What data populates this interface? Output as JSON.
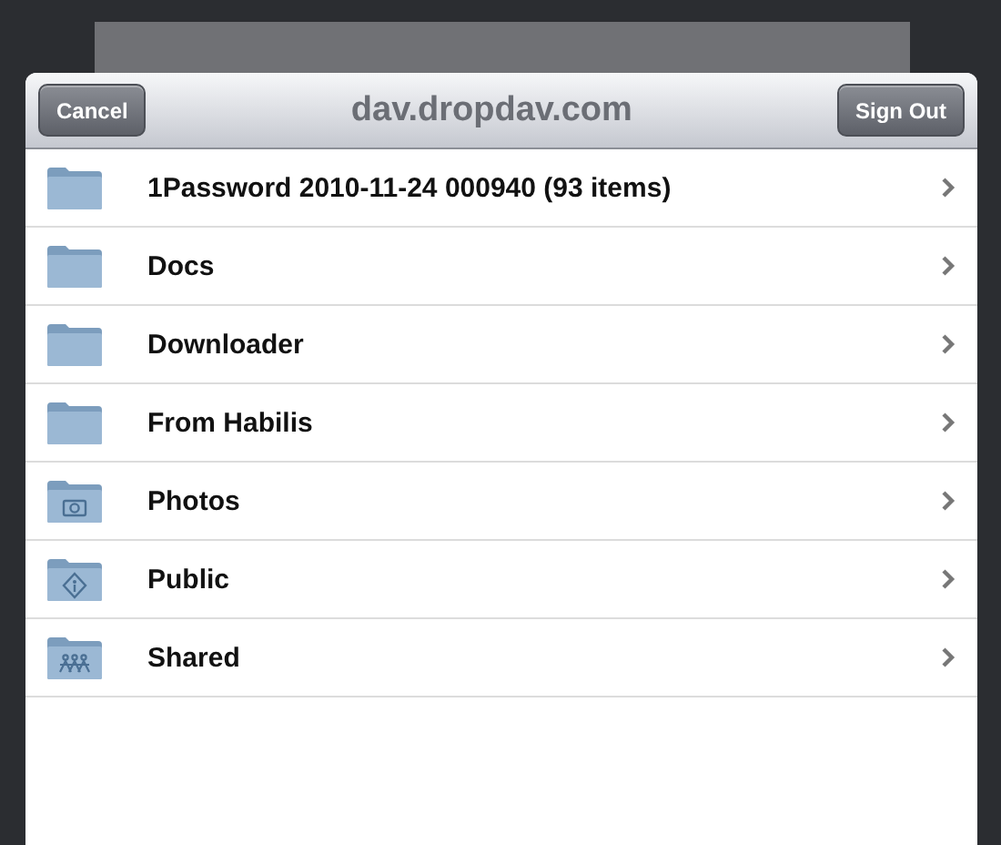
{
  "header": {
    "title": "dav.dropdav.com",
    "left_button": "Cancel",
    "right_button": "Sign Out"
  },
  "items": [
    {
      "label": "1Password 2010-11-24 000940 (93 items)",
      "kind": "plain"
    },
    {
      "label": "Docs",
      "kind": "plain"
    },
    {
      "label": "Downloader",
      "kind": "plain"
    },
    {
      "label": "From Habilis",
      "kind": "plain"
    },
    {
      "label": "Photos",
      "kind": "photos"
    },
    {
      "label": "Public",
      "kind": "public"
    },
    {
      "label": "Shared",
      "kind": "shared"
    }
  ]
}
